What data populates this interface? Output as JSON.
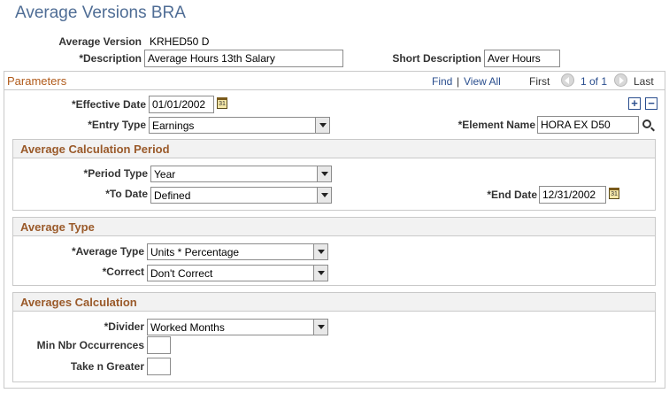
{
  "page": {
    "title": "Average Versions BRA"
  },
  "header": {
    "average_version_label": "Average Version",
    "average_version_value": "KRHED50 D",
    "description_label": "*Description",
    "description_value": "Average Hours 13th Salary",
    "short_description_label": "Short Description",
    "short_description_value": "Aver Hours"
  },
  "parameters": {
    "title": "Parameters",
    "nav": {
      "find": "Find",
      "separator": "|",
      "view_all": "View All",
      "first": "First",
      "counter": "1 of 1",
      "last": "Last"
    },
    "add_icon": "+",
    "remove_icon": "−",
    "effective_date_label": "*Effective Date",
    "effective_date_value": "01/01/2002",
    "calendar_text": "31",
    "entry_type_label": "*Entry Type",
    "entry_type_value": "Earnings",
    "element_name_label": "*Element Name",
    "element_name_value": "HORA EX D50"
  },
  "avg_calc_period": {
    "title": "Average Calculation Period",
    "period_type_label": "*Period Type",
    "period_type_value": "Year",
    "to_date_label": "*To Date",
    "to_date_value": "Defined",
    "end_date_label": "*End Date",
    "end_date_value": "12/31/2002"
  },
  "avg_type": {
    "title": "Average Type",
    "average_type_label": "*Average Type",
    "average_type_value": "Units * Percentage",
    "correct_label": "*Correct",
    "correct_value": "Don't Correct"
  },
  "avg_calculation": {
    "title": "Averages Calculation",
    "divider_label": "*Divider",
    "divider_value": "Worked Months",
    "min_nbr_label": "Min Nbr Occurrences",
    "min_nbr_value": "",
    "take_n_label": "Take n Greater",
    "take_n_value": ""
  },
  "colors": {
    "title": "#4f6d95",
    "section_title": "#9a5a2a",
    "link": "#2a4e8e"
  }
}
